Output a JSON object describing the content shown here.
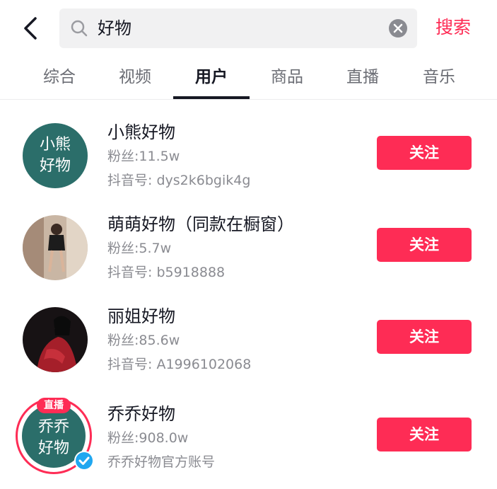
{
  "header": {
    "search_query": "好物",
    "search_button": "搜索"
  },
  "tabs": [
    {
      "label": "综合",
      "active": false
    },
    {
      "label": "视频",
      "active": false
    },
    {
      "label": "用户",
      "active": true
    },
    {
      "label": "商品",
      "active": false
    },
    {
      "label": "直播",
      "active": false
    },
    {
      "label": "音乐",
      "active": false
    }
  ],
  "users": [
    {
      "name": "小熊好物",
      "fans": "粉丝:11.5w",
      "id_line": "抖音号: dys2k6bgik4g",
      "follow": "关注",
      "avatar_text_1": "小熊",
      "avatar_text_2": "好物",
      "avatar_color": "#2b6e6a"
    },
    {
      "name": "萌萌好物（同款在橱窗）",
      "fans": "粉丝:5.7w",
      "id_line": "抖音号: b5918888",
      "follow": "关注",
      "avatar_icon": "woman-photo-icon"
    },
    {
      "name": "丽姐好物",
      "fans": "粉丝:85.6w",
      "id_line": "抖音号: A1996102068",
      "follow": "关注",
      "avatar_icon": "woman-red-dress-photo-icon"
    },
    {
      "name": "乔乔好物",
      "fans": "粉丝:908.0w",
      "id_line": "乔乔好物官方账号",
      "follow": "关注",
      "avatar_text_1": "乔乔",
      "avatar_text_2": "好物",
      "avatar_color": "#2b6e6a",
      "live_badge": "直播",
      "verified": true
    }
  ],
  "colors": {
    "accent": "#fe2c55",
    "text": "#161823",
    "muted": "#8a8b91",
    "avatar_teal": "#2b6e6a"
  }
}
